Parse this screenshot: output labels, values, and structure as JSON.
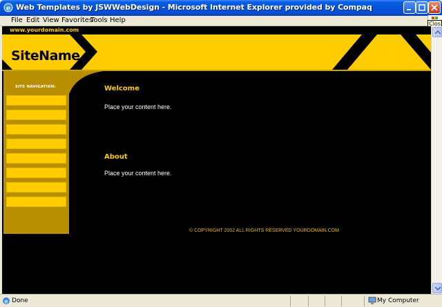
{
  "window": {
    "title": "Web Templates by JSWWebDesign - Microsoft Internet Explorer provided by Compaq"
  },
  "menu": {
    "file": "File",
    "edit": "Edit",
    "view": "View",
    "favorites": "Favorites",
    "tools": "Tools",
    "help": "Help"
  },
  "tooltip": "Clos",
  "page": {
    "domain": "www.yourdomain.com",
    "site_name": "SiteName",
    "nav_label": "SITE NAVIGATION:",
    "nav_buttons": [
      "",
      "",
      "",
      "",
      "",
      "",
      "",
      ""
    ],
    "welcome_heading": "Welcome",
    "welcome_text": "Place your content here.",
    "about_heading": "About",
    "about_text": "Place your content here.",
    "copyright": "© COPYRIGHT 2002 ALL RIGHTS RESERVED YOURDOMAIN.COM"
  },
  "status": {
    "text": "Done",
    "zone": "My Computer"
  },
  "colors": {
    "accent": "#ffcc00",
    "sidebar": "#b88f00",
    "background": "#000000"
  }
}
